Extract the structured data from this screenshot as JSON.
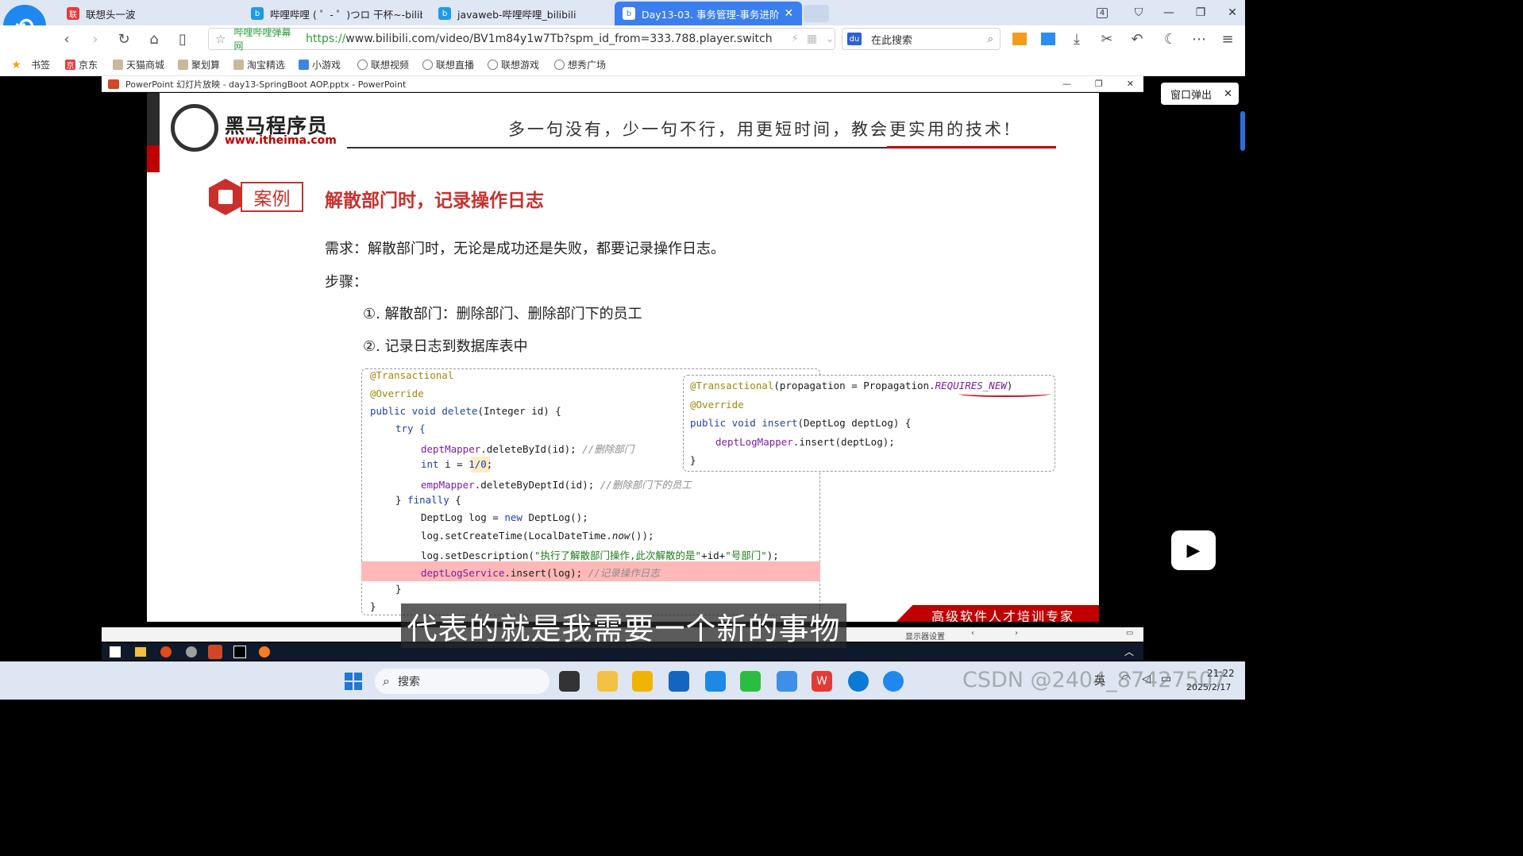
{
  "browser": {
    "tabs": [
      {
        "label": "联想头一波",
        "active": false
      },
      {
        "label": "哔哩哔哩 ( ゜- ゜)つロ 干杯~-bilib",
        "active": false
      },
      {
        "label": "javaweb-哔哩哔哩_bilibili",
        "active": false
      },
      {
        "label": "Day13-03. 事务管理-事务进阶",
        "active": true
      }
    ],
    "tab_count": "4",
    "address": {
      "site_label": "哔哩哔哩弹幕网",
      "url_scheme": "https://",
      "url_rest": "www.bilibili.com/video/BV1m84y1w7Tb?spm_id_from=333.788.player.switch"
    },
    "search_placeholder": "在此搜索",
    "bookmarks": [
      "书签",
      "京东",
      "天猫商城",
      "聚划算",
      "淘宝精选",
      "小游戏",
      "联想视频",
      "联想直播",
      "联想游戏",
      "想秀广场"
    ],
    "popout_label": "窗口弹出"
  },
  "ppt": {
    "window_title": "PowerPoint 幻灯片放映  -  day13-SpringBoot AOP.pptx - PowerPoint",
    "status_left": "显示器设置"
  },
  "slide": {
    "brand_cn": "黑马程序员",
    "brand_url": "www.itheima.com",
    "slogan": "多一句没有，少一句不行，用更短时间，教会更实用的技术!",
    "case_badge": "案例",
    "title": "解散部门时，记录操作日志",
    "requirement": "需求：解散部门时，无论是成功还是失败，都要记录操作日志。",
    "steps_label": "步骤：",
    "steps": [
      "①. 解散部门：删除部门、删除部门下的员工",
      "②. 记录日志到数据库表中"
    ],
    "footer_red": "高级软件人才培训专家",
    "code_left": {
      "l1": "@Transactional",
      "l2": "@Override",
      "l3_kw": "public void ",
      "l3_fn": "delete",
      "l3_rest": "(Integer id) {",
      "l4": "try {",
      "l5_fld": "deptMapper",
      "l5_rest": ".deleteById(id); ",
      "l5_cmt": "//删除部门",
      "l6_kw": "int",
      "l6_rest": " i = ",
      "l6_num": "1/0",
      "l6_end": ";",
      "l7_fld": "empMapper",
      "l7_rest": ".deleteByDeptId(id); ",
      "l7_cmt": "//删除部门下的员工",
      "l8_a": "} ",
      "l8_kw": "finally",
      "l8_b": " {",
      "l9_a": "DeptLog log = ",
      "l9_kw": "new",
      "l9_b": " DeptLog();",
      "l10_a": "log.setCreateTime(LocalDateTime.",
      "l10_it": "now",
      "l10_b": "());",
      "l11_a": "log.setDescription(",
      "l11_str": "\"执行了解散部门操作,此次解散的是\"",
      "l11_b": "+id+",
      "l11_str2": "\"号部门\"",
      "l11_c": ");",
      "l12_fld": "deptLogService",
      "l12_rest": ".insert(log); ",
      "l12_cmt": "//记录操作日志",
      "l13": "}",
      "l14": "}"
    },
    "code_right": {
      "l1_ann": "@Transactional",
      "l1_rest": "(propagation = Propagation.",
      "l1_it": "REQUIRES_NEW",
      "l1_end": ")",
      "l2": "@Override",
      "l3_kw": "public void ",
      "l3_fn": "insert",
      "l3_rest": "(DeptLog deptLog) {",
      "l4_fld": "deptLogMapper",
      "l4_rest": ".insert(deptLog);",
      "l5": "}"
    }
  },
  "subtitle": "代表的就是我需要一个新的事物",
  "taskbar": {
    "search_label": "搜索",
    "lang": "英",
    "time": "21:22",
    "date": "2025/2/17",
    "watermark": "CSDN @2404_87427507"
  }
}
